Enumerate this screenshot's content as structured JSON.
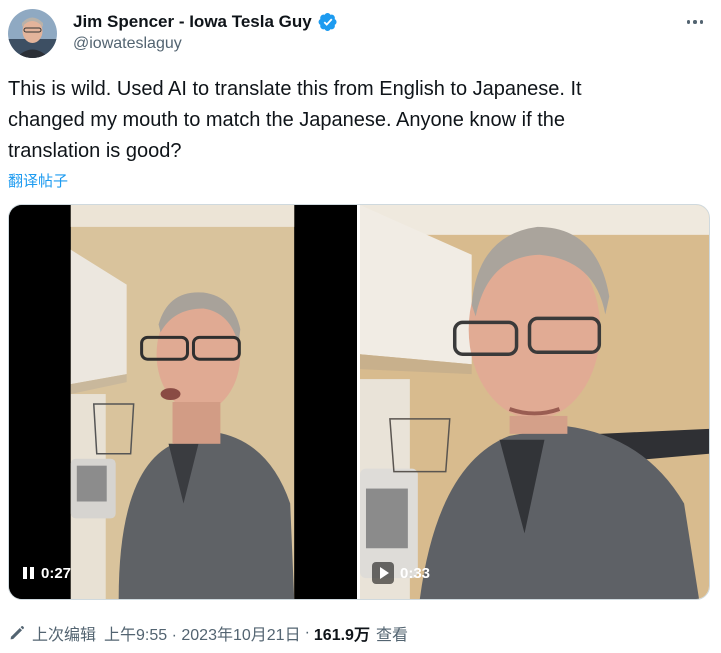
{
  "author": {
    "display_name": "Jim Spencer - Iowa Tesla Guy",
    "handle": "@iowateslaguy",
    "verified_icon": "verified-badge-icon",
    "accent_color": "#1d9bf0"
  },
  "tweet": {
    "text": "This is wild. Used AI to translate this from English to Japanese. It\nchanged my mouth to match the Japanese. Anyone know if the\ntranslation is good?",
    "translate_label": "翻译帖子"
  },
  "media": {
    "videos": [
      {
        "state": "playing",
        "state_icon": "pause-icon",
        "time": "0:27"
      },
      {
        "state": "paused",
        "state_icon": "play-icon",
        "time": "0:33"
      }
    ]
  },
  "meta": {
    "edited_label": "上次编辑",
    "timestamp": "上午9:55 · 2023年10月21日",
    "separator": "·",
    "views_count": "161.9万",
    "views_label": "查看"
  },
  "colors": {
    "text_primary": "#0f1419",
    "text_secondary": "#536471",
    "link": "#1d9bf0"
  }
}
